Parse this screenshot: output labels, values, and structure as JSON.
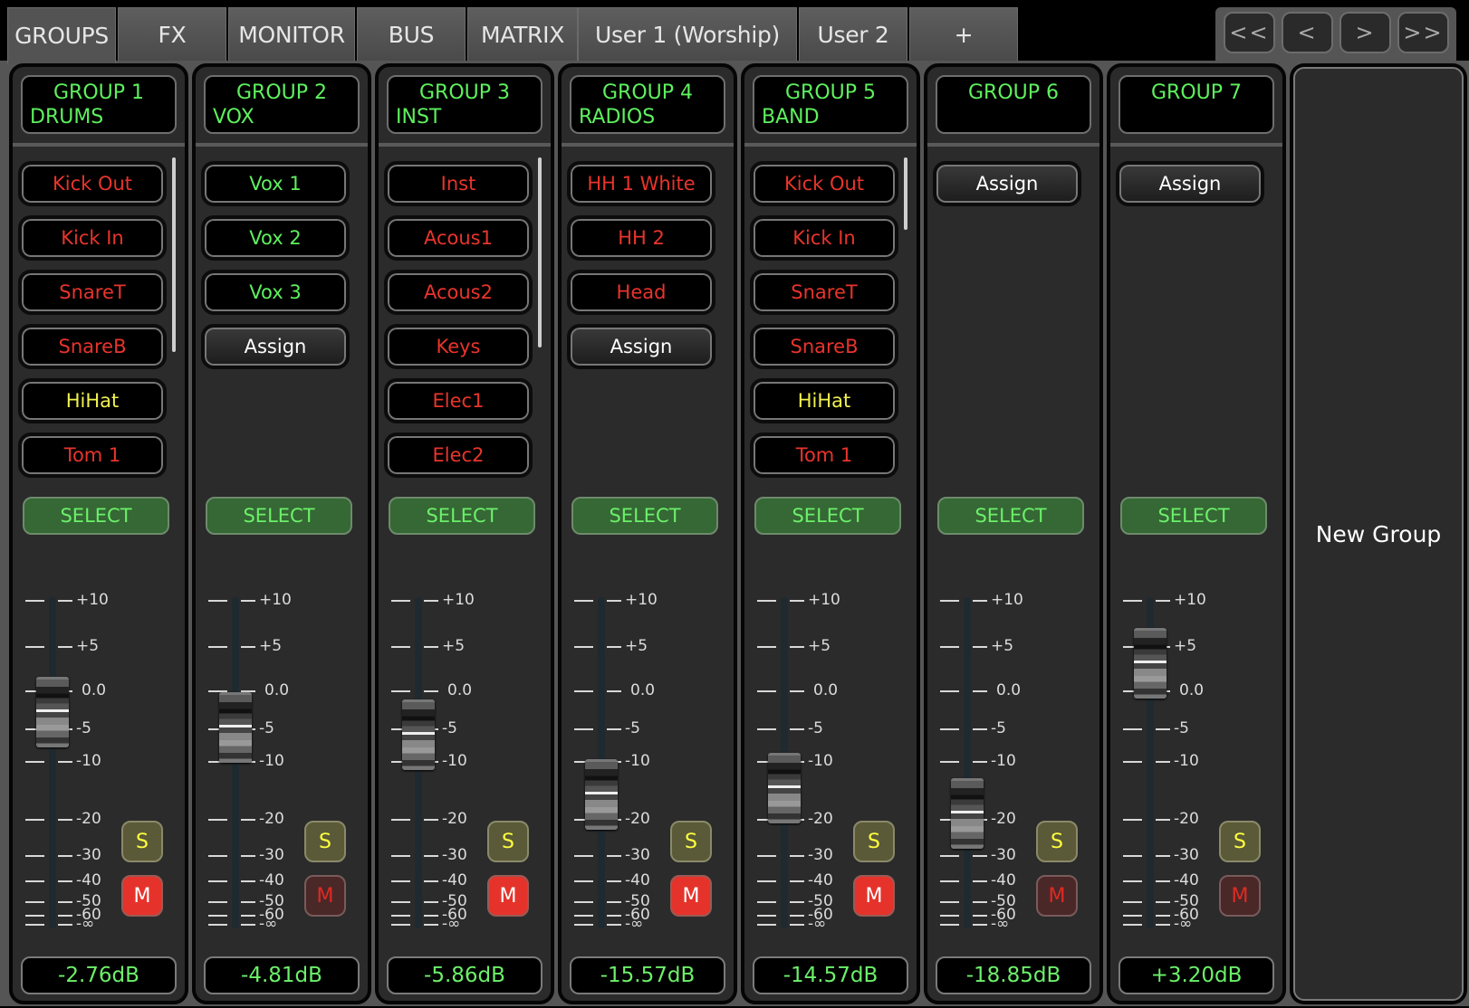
{
  "tabs": [
    {
      "label": "GROUPS",
      "active": true
    },
    {
      "label": "FX",
      "active": false
    },
    {
      "label": "MONITOR",
      "active": false
    },
    {
      "label": "BUS",
      "active": false
    },
    {
      "label": "MATRIX",
      "active": false
    },
    {
      "label": "User 1 (Worship)",
      "active": false
    },
    {
      "label": "User 2",
      "active": false
    },
    {
      "label": "+",
      "active": false
    }
  ],
  "nav": {
    "first": "<<",
    "prev": "<",
    "next": ">",
    "last": ">>"
  },
  "colors": {
    "name_green": "#5ef05e",
    "channel_red": "#e8342c",
    "channel_yellow": "#f0f050",
    "channel_green": "#5ef05e",
    "assign_white": "#ffffff",
    "select_bg": "#356834",
    "mute_on": "#e5332b",
    "solo_yellow": "#ffff40"
  },
  "scale_labels": [
    "+10",
    "+5",
    "0.0",
    "-5",
    "-10",
    "-20",
    "-30",
    "-40",
    "-50",
    "-60",
    "-∞"
  ],
  "select_label": "SELECT",
  "solo_label": "S",
  "mute_label": "M",
  "assign_label": "Assign",
  "groups": [
    {
      "line1": "GROUP 1",
      "line2": "DRUMS",
      "level_db": -2.76,
      "readout": "-2.76dB",
      "muted": true,
      "scrollable": true,
      "channels": [
        {
          "name": "Kick Out",
          "color": "red"
        },
        {
          "name": "Kick In",
          "color": "red"
        },
        {
          "name": "SnareT",
          "color": "red"
        },
        {
          "name": "SnareB",
          "color": "red"
        },
        {
          "name": "HiHat",
          "color": "yellow"
        },
        {
          "name": "Tom 1",
          "color": "red"
        }
      ]
    },
    {
      "line1": "GROUP 2",
      "line2": "VOX",
      "level_db": -4.81,
      "readout": "-4.81dB",
      "muted": false,
      "scrollable": false,
      "channels": [
        {
          "name": "Vox 1",
          "color": "green"
        },
        {
          "name": "Vox 2",
          "color": "green"
        },
        {
          "name": "Vox 3",
          "color": "green"
        },
        {
          "name": "Assign",
          "color": "assign"
        }
      ]
    },
    {
      "line1": "GROUP 3",
      "line2": "INST",
      "level_db": -5.86,
      "readout": "-5.86dB",
      "muted": true,
      "scrollable": true,
      "channels": [
        {
          "name": "Inst",
          "color": "red"
        },
        {
          "name": "Acous1",
          "color": "red"
        },
        {
          "name": "Acous2",
          "color": "red"
        },
        {
          "name": "Keys",
          "color": "red"
        },
        {
          "name": "Elec1",
          "color": "red"
        },
        {
          "name": "Elec2",
          "color": "red"
        }
      ]
    },
    {
      "line1": "GROUP 4",
      "line2": "RADIOS",
      "level_db": -15.57,
      "readout": "-15.57dB",
      "muted": true,
      "scrollable": false,
      "channels": [
        {
          "name": "HH 1 White",
          "color": "red"
        },
        {
          "name": "HH 2",
          "color": "red"
        },
        {
          "name": "Head",
          "color": "red"
        },
        {
          "name": "Assign",
          "color": "assign"
        }
      ]
    },
    {
      "line1": "GROUP 5",
      "line2": "BAND",
      "level_db": -14.57,
      "readout": "-14.57dB",
      "muted": true,
      "scrollable": true,
      "channels": [
        {
          "name": "Kick Out",
          "color": "red"
        },
        {
          "name": "Kick In",
          "color": "red"
        },
        {
          "name": "SnareT",
          "color": "red"
        },
        {
          "name": "SnareB",
          "color": "red"
        },
        {
          "name": "HiHat",
          "color": "yellow"
        },
        {
          "name": "Tom 1",
          "color": "red"
        }
      ]
    },
    {
      "line1": "GROUP 6",
      "line2": "",
      "level_db": -18.85,
      "readout": "-18.85dB",
      "muted": false,
      "scrollable": false,
      "channels": [
        {
          "name": "Assign",
          "color": "assign"
        }
      ]
    },
    {
      "line1": "GROUP 7",
      "line2": "",
      "level_db": 3.2,
      "readout": "+3.20dB",
      "muted": false,
      "scrollable": false,
      "channels": [
        {
          "name": "Assign",
          "color": "assign"
        }
      ]
    }
  ],
  "new_group_label": "New Group"
}
